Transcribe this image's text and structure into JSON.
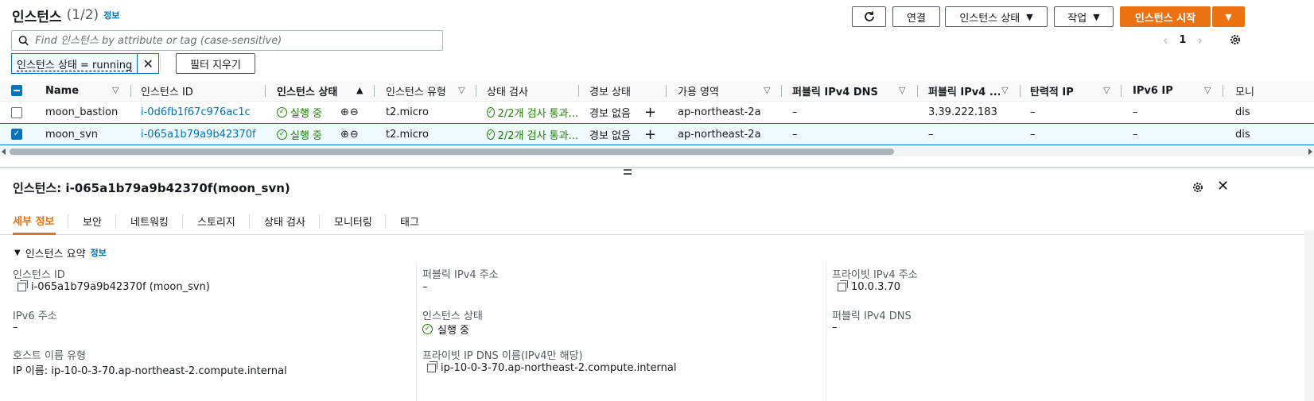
{
  "header": {
    "title": "인스턴스",
    "count": "(1/2)",
    "info": "정보",
    "buttons": {
      "connect": "연결",
      "instance_state": "인스턴스 상태",
      "actions": "작업",
      "launch": "인스턴스 시작"
    }
  },
  "pagination": {
    "page": "1"
  },
  "search": {
    "placeholder": "Find 인스턴스 by attribute or tag (case-sensitive)"
  },
  "filter": {
    "token": "인스턴스 상태 = running",
    "clear_label": "필터 지우기"
  },
  "table": {
    "columns": [
      "Name",
      "인스턴스 ID",
      "인스턴스 상태",
      "인스턴스 유형",
      "상태 검사",
      "경보 상태",
      "가용 영역",
      "퍼블릭 IPv4 DNS",
      "퍼블릭 IPv4 ...",
      "탄력적 IP",
      "IPv6 IP",
      "모니"
    ],
    "rows": [
      {
        "name": "moon_bastion",
        "id": "i-0d6fb1f67c976ac1c",
        "state": "실행 중",
        "type": "t2.micro",
        "check": "2/2개 검사 통과...",
        "alarm": "경보 없음",
        "az": "ap-northeast-2a",
        "public_dns": "–",
        "public_ip": "3.39.222.183",
        "elastic_ip": "–",
        "ipv6": "–",
        "monitoring": "dis",
        "selected": false
      },
      {
        "name": "moon_svn",
        "id": "i-065a1b79a9b42370f",
        "state": "실행 중",
        "type": "t2.micro",
        "check": "2/2개 검사 통과...",
        "alarm": "경보 없음",
        "az": "ap-northeast-2a",
        "public_dns": "–",
        "public_ip": "–",
        "elastic_ip": "–",
        "ipv6": "–",
        "monitoring": "dis",
        "selected": true
      }
    ]
  },
  "details": {
    "title": "인스턴스: i-065a1b79a9b42370f(moon_svn)",
    "tabs": [
      "세부 정보",
      "보안",
      "네트워킹",
      "스토리지",
      "상태 검사",
      "모니터링",
      "태그"
    ],
    "section_title": "인스턴스 요약",
    "section_info": "정보",
    "fields": {
      "instance_id_label": "인스턴스 ID",
      "instance_id_value": "i-065a1b79a9b42370f (moon_svn)",
      "public_ipv4_label": "퍼블릭 IPv4 주소",
      "public_ipv4_value": "–",
      "private_ipv4_label": "프라이빗 IPv4 주소",
      "private_ipv4_value": "10.0.3.70",
      "ipv6_label": "IPv6 주소",
      "ipv6_value": "–",
      "instance_state_label": "인스턴스 상태",
      "instance_state_value": "실행 중",
      "public_dns_label": "퍼블릭 IPv4 DNS",
      "public_dns_value": "–",
      "hostname_type_label": "호스트 이름 유형",
      "hostname_type_value": "IP 이름: ip-10-0-3-70.ap-northeast-2.compute.internal",
      "private_dns_label": "프라이빗 IP DNS 이름(IPv4만 해당)",
      "private_dns_value": "ip-10-0-3-70.ap-northeast-2.compute.internal"
    }
  },
  "colors": {
    "accent": "#ec7211",
    "link": "#0073bb",
    "success": "#1d8102"
  }
}
